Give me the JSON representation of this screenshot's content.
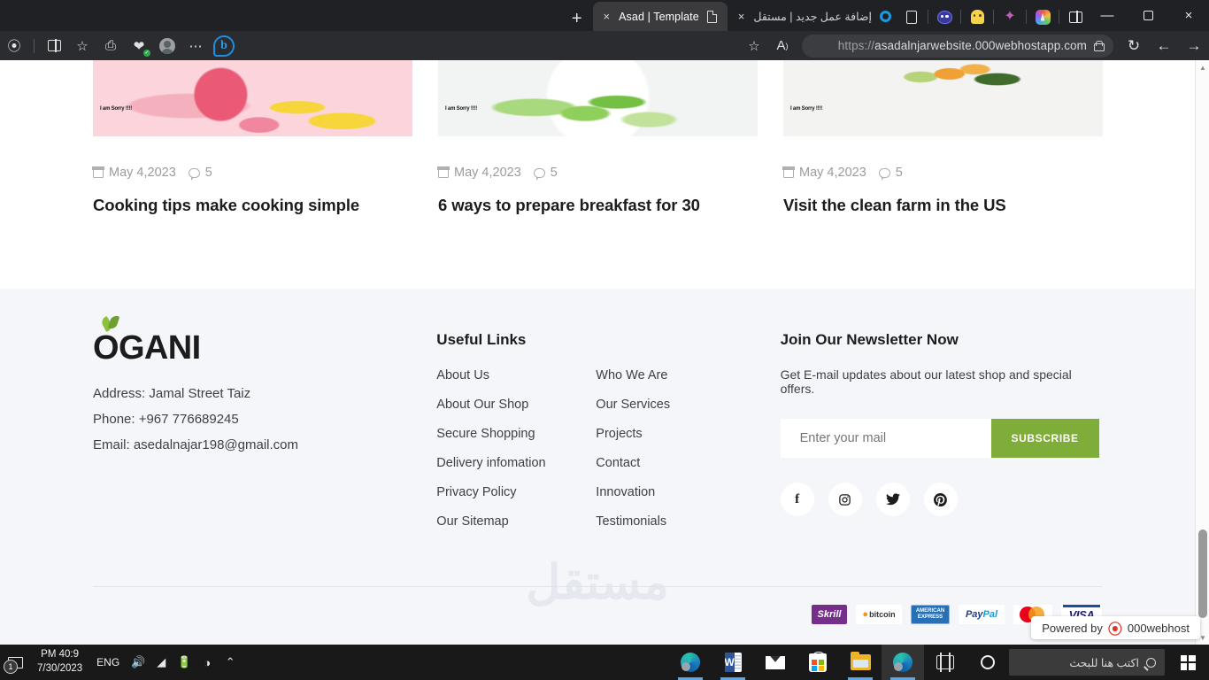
{
  "browser": {
    "tabs": [
      {
        "title": "Asad | Template",
        "favicon": "document-icon",
        "active": true,
        "close_label": "×"
      },
      {
        "title": "إضافة عمل جديد | مستقل",
        "favicon": "ring-icon",
        "active": false,
        "close_label": "×"
      }
    ],
    "new_tab_label": "+",
    "window_controls": {
      "minimize": "—",
      "maximize": "□",
      "close": "×"
    },
    "address": {
      "scheme": "https://",
      "host": "asadalnjarwebsite.000webhostapp.com",
      "lock": "lock-icon"
    },
    "nav": {
      "forward": "→",
      "back": "←",
      "refresh": "↻"
    },
    "toolbar_icons": [
      "bing-icon",
      "more-icon",
      "profile-avatar-icon",
      "health-icon",
      "collections-icon",
      "favorites-list-icon",
      "split-screen-icon",
      "extensions-icon",
      "add-favorite-star-icon",
      "read-aloud-icon"
    ],
    "extension_icons": [
      "page-icon",
      "robot-icon",
      "ghost-icon",
      "copilot-sparkle-icon",
      "rainbow-app-icon",
      "split-pane-icon"
    ],
    "more_label": "⋯",
    "bing_label": "b",
    "star_label": "☆",
    "read_aloud_label": "A"
  },
  "blog": {
    "cards": [
      {
        "image": "pink-grapefruit-lemons",
        "overlay_text": "I am Sorry !!!!",
        "date": "May 4,2023",
        "comments": "5",
        "title": "Cooking tips make cooking simple"
      },
      {
        "image": "green-peas-pods",
        "overlay_text": "I am Sorry !!!!",
        "date": "May 4,2023",
        "comments": "5",
        "title": "6 ways to prepare breakfast for 30"
      },
      {
        "image": "citrus-oranges-limes",
        "overlay_text": "I am Sorry !!!!",
        "date": "May 4,2023",
        "comments": "5",
        "title": "Visit the clean farm in the US"
      }
    ]
  },
  "footer": {
    "brand": {
      "logo_text": "OGANI",
      "leaf_icon": "leaf-icon",
      "address": "Address: Jamal Street Taiz",
      "phone": "Phone: +967 776689245",
      "email": "Email: asedalnajar198@gmail.com"
    },
    "links": {
      "heading": "Useful Links",
      "col1": [
        "About Us",
        "About Our Shop",
        "Secure Shopping",
        "Delivery infomation",
        "Privacy Policy",
        "Our Sitemap"
      ],
      "col2": [
        "Who We Are",
        "Our Services",
        "Projects",
        "Contact",
        "Innovation",
        "Testimonials"
      ]
    },
    "newsletter": {
      "heading": "Join Our Newsletter Now",
      "subtext": "Get E-mail updates about our latest shop and special offers.",
      "placeholder": "Enter your mail",
      "input_value": "",
      "button": "SUBSCRIBE",
      "button_color": "#7fad39"
    },
    "socials": [
      {
        "name": "facebook",
        "glyph": "f"
      },
      {
        "name": "instagram",
        "glyph": "□"
      },
      {
        "name": "twitter",
        "glyph": "ᵥ"
      },
      {
        "name": "pinterest",
        "glyph": "P"
      }
    ],
    "payments": [
      {
        "name": "Skrill",
        "label": "Skrill"
      },
      {
        "name": "bitcoin",
        "label": "bitcoin",
        "symbol": "₿"
      },
      {
        "name": "american-express",
        "line1": "AMERICAN",
        "line2": "EXPRESS"
      },
      {
        "name": "paypal",
        "label": "Pay",
        "label2": "Pal"
      },
      {
        "name": "mastercard",
        "label": ""
      },
      {
        "name": "visa",
        "label": "VISA"
      }
    ],
    "watermark": "مستقل"
  },
  "powered_badge": {
    "text": "Powered by",
    "brand": "000webhost",
    "logo": "webhost-logo-icon"
  },
  "taskbar": {
    "start": "windows-logo-icon",
    "search_placeholder": "اكتب هنا للبحث",
    "apps": [
      {
        "name": "edge",
        "active": false,
        "running": true
      },
      {
        "name": "word",
        "active": false,
        "running": true
      },
      {
        "name": "mail",
        "active": false,
        "running": false
      },
      {
        "name": "microsoft-store",
        "active": false,
        "running": false
      },
      {
        "name": "file-explorer",
        "active": false,
        "running": true
      },
      {
        "name": "edge-active",
        "active": true,
        "running": true
      },
      {
        "name": "task-view",
        "active": false,
        "running": false
      },
      {
        "name": "cortana",
        "active": false,
        "running": false
      }
    ],
    "tray": {
      "chevron": "⌃",
      "icons": [
        "meet-now-icon",
        "battery-icon",
        "wifi-icon",
        "volume-icon"
      ],
      "volume_glyph": "🔊",
      "language": "ENG",
      "time": "PM 40:9",
      "date": "7/30/2023",
      "notification_count": "1"
    }
  }
}
